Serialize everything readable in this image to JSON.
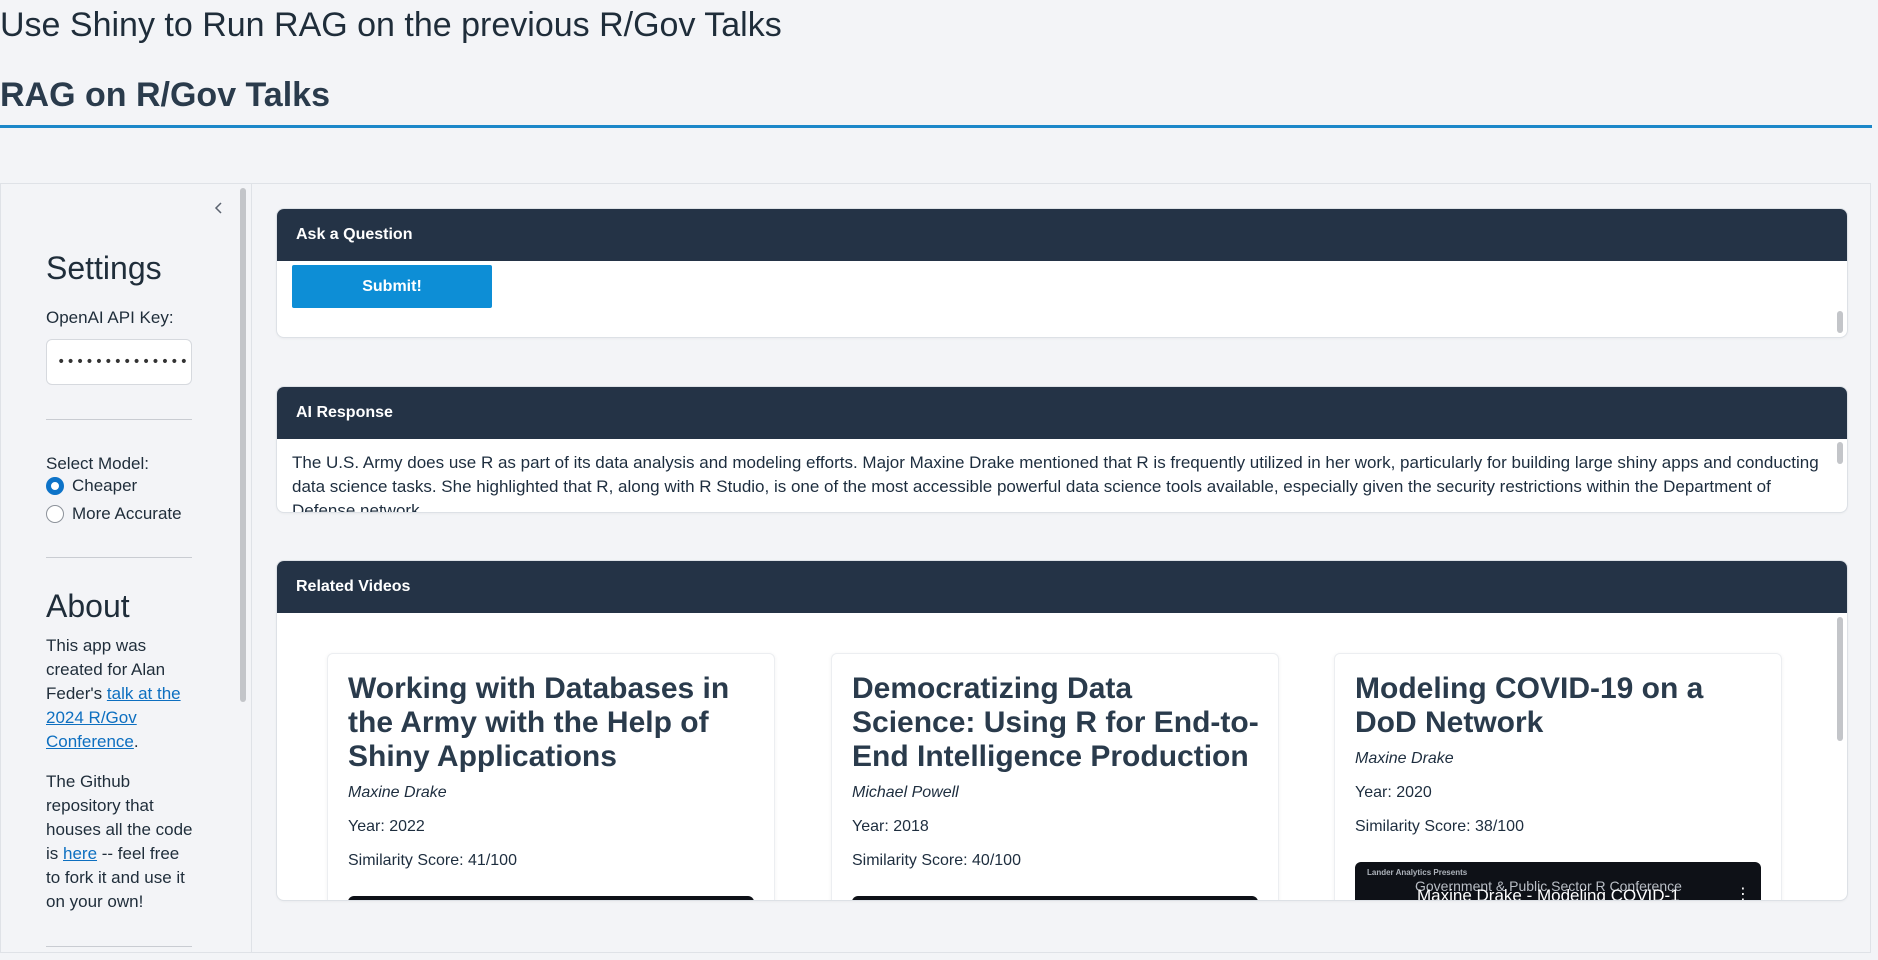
{
  "page": {
    "title": "Use Shiny to Run RAG on the previous R/Gov Talks",
    "app_title": "RAG on R/Gov Talks"
  },
  "colors": {
    "accent": "#1b87c9",
    "card_header": "#243346",
    "button": "#0d8ed6",
    "link": "#0d6fc0",
    "radio_checked": "#0d73c8"
  },
  "sidebar": {
    "collapse_icon": "chevron-left-icon",
    "settings_heading": "Settings",
    "api_key_label": "OpenAI API Key:",
    "api_key_value": "••••••••••••••••••••",
    "model_label": "Select Model:",
    "model_options": [
      {
        "label": "Cheaper",
        "selected": true
      },
      {
        "label": "More Accurate",
        "selected": false
      }
    ],
    "about_heading": "About",
    "about_p1_before": "This app was created for Alan Feder's ",
    "about_p1_link": "talk at the 2024 R/Gov Conference",
    "about_p1_after": ".",
    "about_p2_before": "The Github repository that houses all the code is ",
    "about_p2_link": "here",
    "about_p2_after": " -- feel free to fork it and use it on your own!"
  },
  "question_card": {
    "header": "Ask a Question",
    "submit_label": "Submit!"
  },
  "response_card": {
    "header": "AI Response",
    "text": "The U.S. Army does use R as part of its data analysis and modeling efforts. Major Maxine Drake mentioned that R is frequently utilized in her work, particularly for building large shiny apps and conducting data science tasks. She highlighted that R, along with R Studio, is one of the most accessible powerful data science tools available, especially given the security restrictions within the Department of Defense network."
  },
  "videos_card": {
    "header": "Related Videos",
    "videos": [
      {
        "title": "Working with Databases in the Army with the Help of Shiny Applications",
        "author": "Maxine Drake",
        "year": "Year: 2022",
        "similarity": "Similarity Score: 41/100"
      },
      {
        "title": "Democratizing Data Science: Using R for End-to-End Intelligence Production",
        "author": "Michael Powell",
        "year": "Year: 2018",
        "similarity": "Similarity Score: 40/100"
      },
      {
        "title": "Modeling COVID-19 on a DoD Network",
        "author": "Maxine Drake",
        "year": "Year: 2020",
        "similarity": "Similarity Score: 38/100",
        "thumbnail": {
          "brand": "Lander Analytics Presents",
          "line1": "Government & Public Sector R Conference",
          "line2": "Maxine Drake - Modeling COVID-1"
        }
      }
    ]
  }
}
